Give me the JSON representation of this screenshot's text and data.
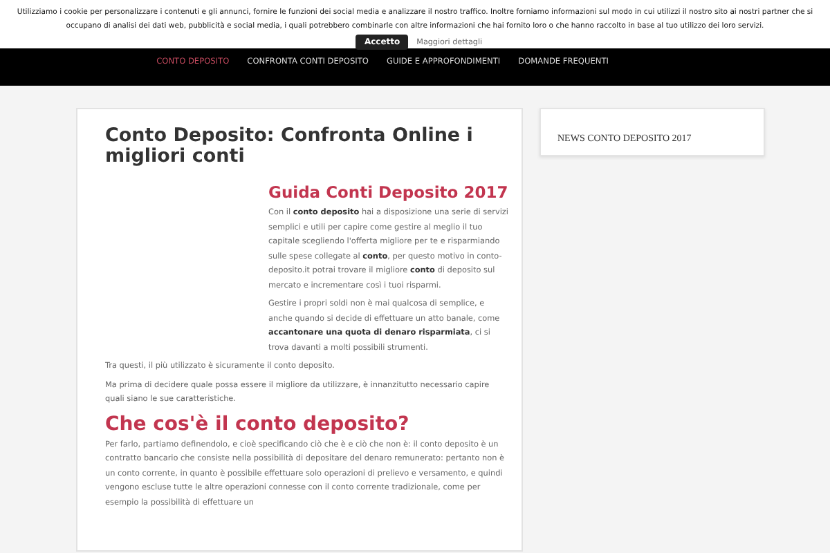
{
  "cookie_bar": {
    "text": "Utilizziamo i cookie per personalizzare i contenuti e gli annunci, fornire le funzioni dei social media e analizzare il nostro traffico. Inoltre forniamo informazioni sul modo in cui utilizzi il nostro sito ai nostri partner che si occupano di analisi dei dati web, pubblicità e social media, i quali potrebbero combinarle con altre informazioni che hai fornito loro o che hanno raccolto in base al tuo utilizzo dei loro servizi.",
    "accept": "Accetto",
    "more": "Maggiori dettagli"
  },
  "nav": [
    {
      "label": "CONTO DEPOSITO",
      "selected": true
    },
    {
      "label": "CONFRONTA CONTI DEPOSITO",
      "selected": false
    },
    {
      "label": "GUIDE E APPROFONDIMENTI",
      "selected": false
    },
    {
      "label": "DOMANDE FREQUENTI",
      "selected": false
    }
  ],
  "article": {
    "title": "Conto Deposito: Confronta Online i migliori conti",
    "intro_heading": "Guida Conti Deposito 2017",
    "intro_paragraphs": [
      "Con il **conto deposito** hai a disposizione una serie di servizi semplici e utili per capire come gestire al meglio il tuo capitale scegliendo l'offerta migliore per te e risparmiando sulle spese collegate al **conto**, per questo motivo in conto-deposito.it potrai trovare il migliore **conto** di deposito sul mercato e incrementare così i tuoi risparmi.",
      "Gestire i propri soldi non è mai qualcosa di semplice, e anche quando si decide di effettuare un atto banale, come **accantonare una quota di denaro risparmiata**, ci si trova davanti a molti possibili strumenti."
    ],
    "paragraphs": [
      "Tra questi, il più utilizzato è sicuramente il conto deposito.",
      "Ma prima di decidere quale possa essere il migliore da utilizzare, è innanzitutto necessario capire quali siano le sue caratteristiche."
    ],
    "section_heading": "Che cos'è il conto deposito?",
    "section_text": "Per farlo, partiamo definendolo, e cioè specificando ciò che è e ciò che non è: il conto deposito è un contratto bancario che consiste nella possibilità di depositare del denaro remunerato: pertanto non è un conto corrente, in quanto è possibile effettuare solo operazioni di prelievo e versamento, e quindi vengono escluse tutte le altre operazioni connesse con il conto corrente tradizionale, come per esempio la possibilità di effettuare un"
  },
  "sidebar": {
    "widget_title": "NEWS CONTO DEPOSITO 2017"
  }
}
